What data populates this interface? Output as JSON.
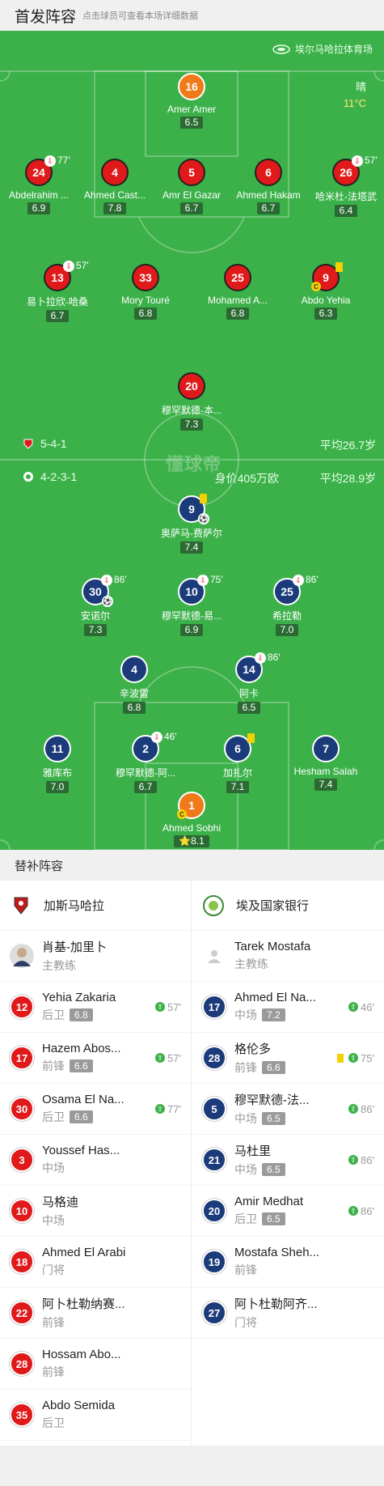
{
  "header": {
    "title": "首发阵容",
    "hint": "点击球员可查看本场详细数据"
  },
  "venue": "埃尔马哈拉体育场",
  "weather": {
    "cond": "晴",
    "temp": "11°C"
  },
  "watermark": "懂球帝",
  "home_team": {
    "formation": "5-4-1",
    "avg_age": "平均26.7岁"
  },
  "away_team": {
    "formation": "4-2-3-1",
    "value": "身价405万欧",
    "avg_age": "平均28.9岁"
  },
  "home_players": [
    {
      "num": "16",
      "name": "Amer Amer",
      "rating": "6.5"
    },
    {
      "num": "24",
      "name": "Abdelrahim ...",
      "rating": "6.9",
      "sub": "77'"
    },
    {
      "num": "4",
      "name": "Ahmed Cast...",
      "rating": "7.8"
    },
    {
      "num": "5",
      "name": "Amr El Gazar",
      "rating": "6.7"
    },
    {
      "num": "6",
      "name": "Ahmed Hakam",
      "rating": "6.7"
    },
    {
      "num": "26",
      "name": "哈米杜-法塔武",
      "rating": "6.4",
      "sub": "57'"
    },
    {
      "num": "13",
      "name": "易卜拉欣-哈桑",
      "rating": "6.7",
      "sub": "57'"
    },
    {
      "num": "33",
      "name": "Mory Touré",
      "rating": "6.8"
    },
    {
      "num": "25",
      "name": "Mohamed A...",
      "rating": "6.8"
    },
    {
      "num": "9",
      "name": "Abdo Yehia",
      "rating": "6.3",
      "cap": "C"
    },
    {
      "num": "20",
      "name": "穆罕默德-本...",
      "rating": "7.3"
    }
  ],
  "away_players": [
    {
      "num": "9",
      "name": "奥萨马-费萨尔",
      "rating": "7.4"
    },
    {
      "num": "30",
      "name": "安诺尔",
      "rating": "7.3",
      "sub": "86'"
    },
    {
      "num": "10",
      "name": "穆罕默德-易...",
      "rating": "6.9",
      "sub": "75'"
    },
    {
      "num": "25",
      "name": "希拉勒",
      "rating": "7.0",
      "sub": "86'"
    },
    {
      "num": "4",
      "name": "辛波雷",
      "rating": "6.8"
    },
    {
      "num": "14",
      "name": "阿卡",
      "rating": "6.5",
      "sub": "86'"
    },
    {
      "num": "11",
      "name": "雅库布",
      "rating": "7.0"
    },
    {
      "num": "2",
      "name": "穆罕默德-阿...",
      "rating": "6.7",
      "sub": "46'"
    },
    {
      "num": "6",
      "name": "加扎尔",
      "rating": "7.1"
    },
    {
      "num": "7",
      "name": "Hesham Salah",
      "rating": "7.4"
    },
    {
      "num": "1",
      "name": "Ahmed Sobhi",
      "rating": "8.1",
      "cap": "C"
    }
  ],
  "subs_title": "替补阵容",
  "home_subs": {
    "team": "加斯马哈拉",
    "coach": {
      "name": "肖基-加里卜",
      "role": "主教练"
    },
    "players": [
      {
        "num": "12",
        "name": "Yehia Zakaria",
        "pos": "后卫",
        "rating": "6.8",
        "time": "57'"
      },
      {
        "num": "17",
        "name": "Hazem Abos...",
        "pos": "前锋",
        "rating": "6.6",
        "time": "57'"
      },
      {
        "num": "30",
        "name": "Osama El Na...",
        "pos": "后卫",
        "rating": "6.6",
        "time": "77'"
      },
      {
        "num": "3",
        "name": "Youssef Has...",
        "pos": "中场"
      },
      {
        "num": "10",
        "name": "马格迪",
        "pos": "中场"
      },
      {
        "num": "18",
        "name": "Ahmed El Arabi",
        "pos": "门将"
      },
      {
        "num": "22",
        "name": "阿卜杜勒纳赛...",
        "pos": "前锋"
      },
      {
        "num": "28",
        "name": "Hossam Abo...",
        "pos": "前锋"
      },
      {
        "num": "35",
        "name": "Abdo Semida",
        "pos": "后卫"
      }
    ]
  },
  "away_subs": {
    "team": "埃及国家银行",
    "coach": {
      "name": "Tarek Mostafa",
      "role": "主教练"
    },
    "players": [
      {
        "num": "17",
        "name": "Ahmed El Na...",
        "pos": "中场",
        "rating": "7.2",
        "time": "46'"
      },
      {
        "num": "28",
        "name": "格伦多",
        "pos": "前锋",
        "rating": "6.6",
        "time": "75'",
        "card": true
      },
      {
        "num": "5",
        "name": "穆罕默德-法...",
        "pos": "中场",
        "rating": "6.5",
        "time": "86'"
      },
      {
        "num": "21",
        "name": "马杜里",
        "pos": "中场",
        "rating": "6.5",
        "time": "86'"
      },
      {
        "num": "20",
        "name": "Amir Medhat",
        "pos": "后卫",
        "rating": "6.5",
        "time": "86'"
      },
      {
        "num": "19",
        "name": "Mostafa Sheh...",
        "pos": "前锋"
      },
      {
        "num": "27",
        "name": "阿卜杜勒阿齐...",
        "pos": "门将"
      }
    ]
  },
  "colors": {
    "pitch": "#3cb14a",
    "home": "#e01a1a",
    "away": "#1c3b7a",
    "gk": "#f07a1a"
  }
}
